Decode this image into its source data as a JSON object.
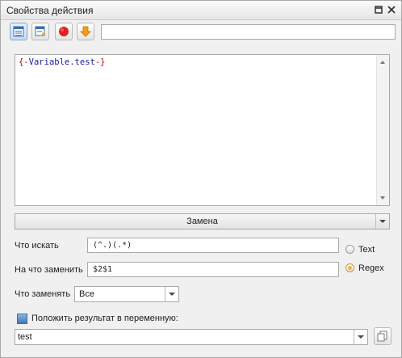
{
  "window": {
    "title": "Свойства действия"
  },
  "toolbar": {
    "buttons": [
      {
        "icon": "table-view-icon",
        "selected": true
      },
      {
        "icon": "edit-form-icon",
        "selected": false
      },
      {
        "icon": "record-icon",
        "selected": false,
        "color": "#e02020"
      },
      {
        "icon": "arrow-down-icon",
        "selected": false,
        "color": "#f0a010"
      }
    ],
    "input_value": ""
  },
  "editor": {
    "open": "{-",
    "variable": "Variable.test",
    "close": "-}"
  },
  "mode_select": {
    "value": "Замена"
  },
  "search": {
    "label": "Что искать",
    "value": "(^.)(.*)"
  },
  "replace": {
    "label": "На что заменить",
    "value": "$2$1"
  },
  "type_options": [
    {
      "label": "Text",
      "selected": false
    },
    {
      "label": "Regex",
      "selected": true
    }
  ],
  "what_replace": {
    "label": "Что заменять",
    "value": "Все"
  },
  "result": {
    "label": "Положить результат в переменную:",
    "checked": true,
    "value": "test"
  },
  "colors": {
    "accent": "#4a86c5",
    "radio_selected": "#f0b54a"
  }
}
